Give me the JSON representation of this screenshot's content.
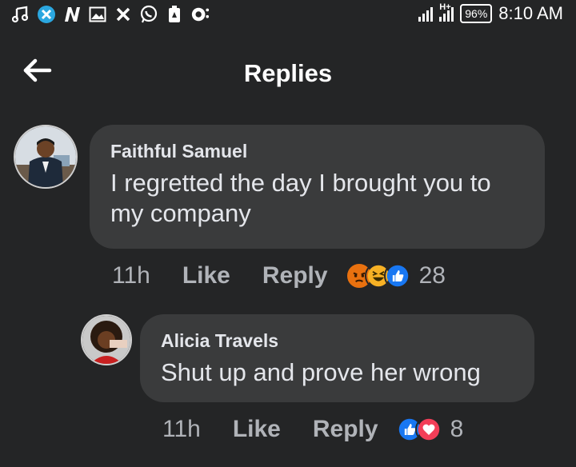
{
  "status_bar": {
    "battery": "96%",
    "network": "H+",
    "time": "8:10 AM",
    "icons": [
      "music-note-icon",
      "x-icon",
      "n-icon",
      "image-icon",
      "x-logo-icon",
      "whatsapp-icon",
      "battery-saver-icon",
      "location-icon"
    ]
  },
  "header": {
    "title": "Replies",
    "back_icon": "arrow-left-icon"
  },
  "comments": [
    {
      "author": "Faithful Samuel",
      "text_line1": "I regretted the day I brought you to",
      "text_line2": "my company",
      "time": "11h",
      "like_label": "Like",
      "reply_label": "Reply",
      "reactions": [
        "angry",
        "haha",
        "like"
      ],
      "reaction_count": "28"
    },
    {
      "author": "Alicia Travels",
      "text": "Shut up and prove her wrong",
      "time": "11h",
      "like_label": "Like",
      "reply_label": "Reply",
      "reactions": [
        "like",
        "love"
      ],
      "reaction_count": "8"
    }
  ],
  "colors": {
    "background": "#242526",
    "bubble": "#3a3b3c",
    "text": "#e4e6eb",
    "muted": "#b0b3b8",
    "like_blue": "#1877f2",
    "love_red": "#f33e58",
    "angry_orange": "#e9710f",
    "haha_yellow": "#f7b125"
  }
}
